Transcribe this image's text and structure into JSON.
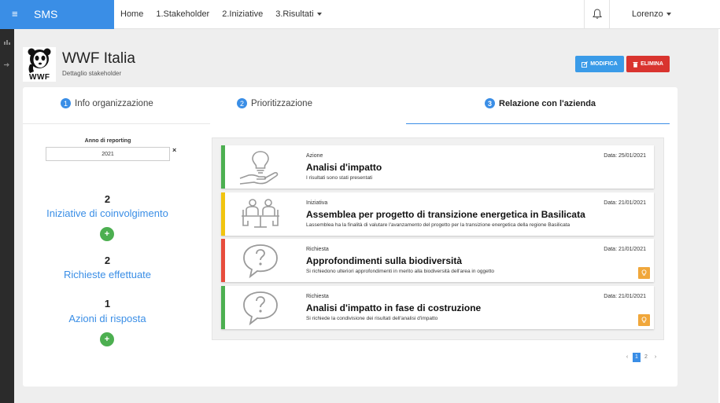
{
  "app": {
    "brand": "SMS"
  },
  "nav": [
    {
      "label": "Home"
    },
    {
      "label": "1.Stakeholder"
    },
    {
      "label": "2.Iniziative"
    },
    {
      "label": "3.Risultati"
    }
  ],
  "user": {
    "name": "Lorenzo"
  },
  "header": {
    "title": "WWF Italia",
    "subtitle": "Dettaglio stakeholder",
    "logo_text": "WWF"
  },
  "actions": {
    "edit_label": "MODIFICA",
    "delete_label": "ELIMINA"
  },
  "tabs": [
    {
      "num": "1",
      "label": "Info organizzazione"
    },
    {
      "num": "2",
      "label": "Prioritizzazione"
    },
    {
      "num": "3",
      "label": "Relazione con l'azienda"
    }
  ],
  "filter": {
    "label": "Anno di reporting",
    "value": "2021",
    "clear": "×"
  },
  "stats": [
    {
      "count": "2",
      "label": "Iniziative di coinvolgimento"
    },
    {
      "count": "2",
      "label": "Richieste effettuate"
    },
    {
      "count": "1",
      "label": "Azioni di risposta"
    }
  ],
  "items": [
    {
      "type": "Azione",
      "date": "Data: 25/01/2021",
      "title": "Analisi d'impatto",
      "description": "I risultati sono stati presentati",
      "color": "#4caf50",
      "icon": "lightbulb-hand-icon",
      "badge": false
    },
    {
      "type": "Iniziativa",
      "date": "Data: 21/01/2021",
      "title": "Assemblea per progetto di transizione energetica in Basilicata",
      "description": "Lassemblea ha la finalità di valutare l'avanzamento del progetto per la transizione energetica della regione Basilicata",
      "color": "#f1c40f",
      "icon": "meeting-icon",
      "badge": false
    },
    {
      "type": "Richiesta",
      "date": "Data: 21/01/2021",
      "title": "Approfondimenti sulla biodiversità",
      "description": "Si richiedono ulteriori approfondimenti in merito alla biodiversità dell'area in oggetto",
      "color": "#e74c3c",
      "icon": "question-bubble-icon",
      "badge": true
    },
    {
      "type": "Richiesta",
      "date": "Data: 21/01/2021",
      "title": "Analisi d'impatto in fase di costruzione",
      "description": "Si richiede la condivisione dei risultati dell'analisi d'impatto",
      "color": "#4caf50",
      "icon": "question-bubble-icon",
      "badge": true
    }
  ],
  "pagination": {
    "prev": "‹",
    "pages": [
      "1",
      "2"
    ],
    "current": "1",
    "next": "›"
  },
  "colors": {
    "primary": "#3a8ee6",
    "danger": "#d9342f",
    "success": "#4caf50",
    "warning": "#f0a73b"
  }
}
